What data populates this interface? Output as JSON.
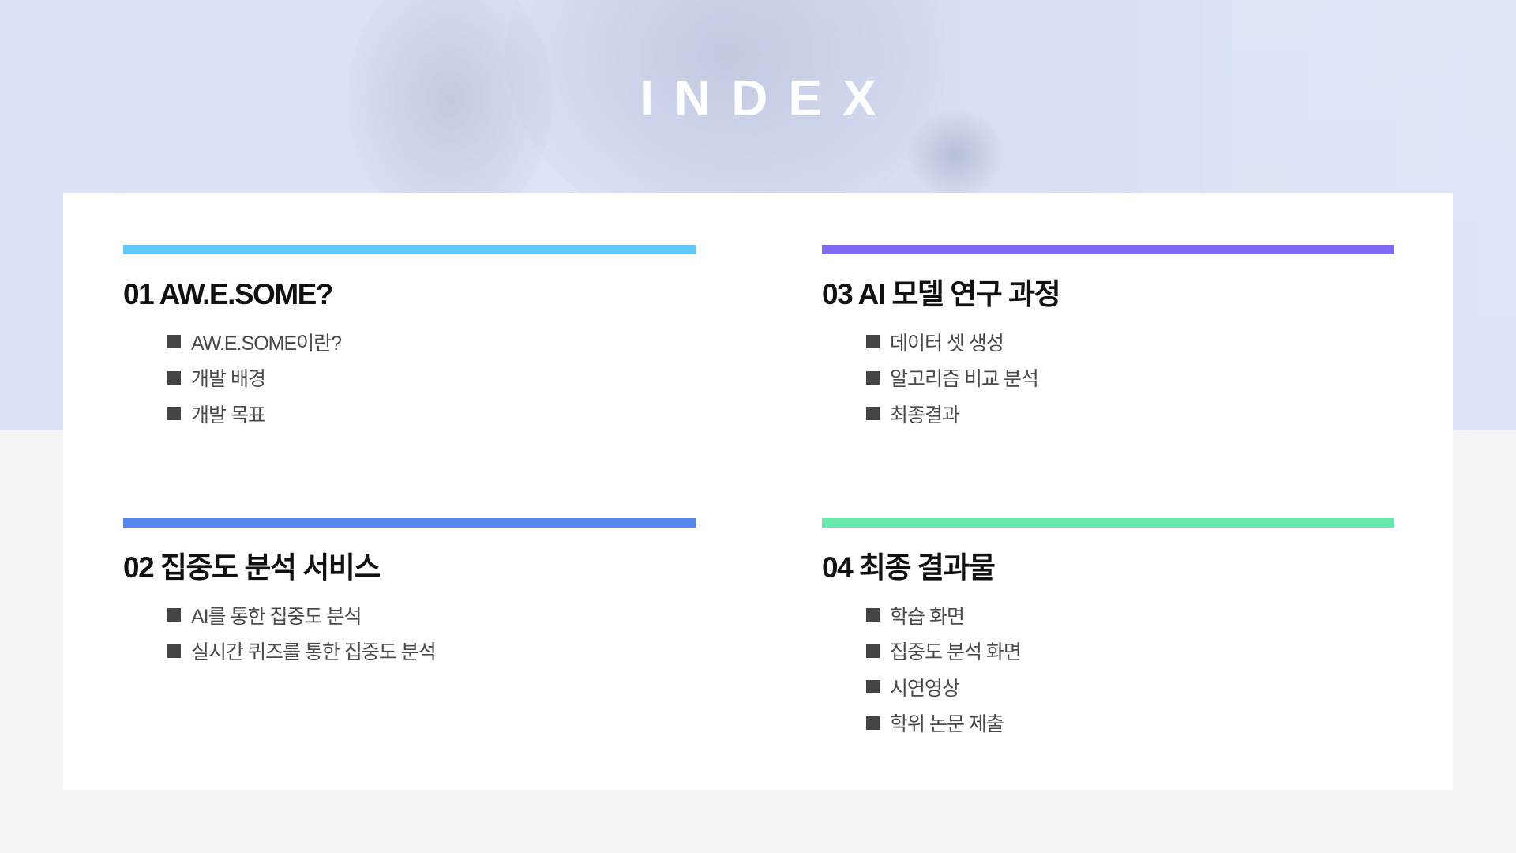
{
  "title": "INDEX",
  "colors": {
    "section_01": "#5fc8f9",
    "section_02": "#5887f1",
    "section_03": "#8168f0",
    "section_04": "#68e8ac"
  },
  "sections": [
    {
      "heading": "01 AW.E.SOME?",
      "items": [
        "AW.E.SOME이란?",
        "개발 배경",
        "개발 목표"
      ]
    },
    {
      "heading": "02 집중도 분석 서비스",
      "items": [
        "AI를 통한 집중도 분석",
        "실시간 퀴즈를 통한 집중도 분석"
      ]
    },
    {
      "heading": "03 AI 모델 연구 과정",
      "items": [
        "데이터 셋 생성",
        "알고리즘 비교 분석",
        "최종결과"
      ]
    },
    {
      "heading": "04 최종 결과물",
      "items": [
        "학습 화면",
        "집중도 분석 화면",
        "시연영상",
        "학위 논문 제출"
      ]
    }
  ]
}
